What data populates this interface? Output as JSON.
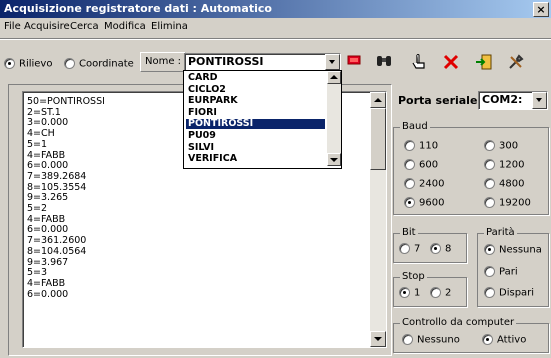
{
  "window": {
    "title": "Acquisizione registratore dati : Automatico",
    "close": "×"
  },
  "menu": [
    "File",
    "Acquisire",
    "Cerca",
    "Modifica",
    "Elimina"
  ],
  "toolbar": {
    "mode_options": [
      {
        "label": "Rilievo",
        "selected": true
      },
      {
        "label": "Coordinate",
        "selected": false
      }
    ],
    "nome_label": "Nome :",
    "nome_value": "PONTIROSSI"
  },
  "dropdown": {
    "items": [
      "CARD",
      "CICLO2",
      "EURPARK",
      "FIORI",
      "PONTIROSSI",
      "PU09",
      "SILVI",
      "VERIFICA"
    ],
    "selected": "PONTIROSSI"
  },
  "data_lines": [
    "50=PONTIROSSI",
    "2=ST.1",
    "3=0.000",
    "4=CH",
    "5=1",
    "4=FABB",
    "6=0.000",
    "7=389.2684",
    "8=105.3554",
    "9=3.265",
    "5=2",
    "4=FABB",
    "6=0.000",
    "7=361.2600",
    "8=104.0564",
    "9=3.967",
    "5=3",
    "4=FABB",
    "6=0.000"
  ],
  "serial": {
    "label": "Porta seriale",
    "value": "COM2:"
  },
  "baud": {
    "label": "Baud",
    "options": [
      {
        "label": "110",
        "selected": false
      },
      {
        "label": "300",
        "selected": false
      },
      {
        "label": "600",
        "selected": false
      },
      {
        "label": "1200",
        "selected": false
      },
      {
        "label": "2400",
        "selected": false
      },
      {
        "label": "4800",
        "selected": false
      },
      {
        "label": "9600",
        "selected": true
      },
      {
        "label": "19200",
        "selected": false
      }
    ]
  },
  "bit": {
    "label": "Bit",
    "options": [
      {
        "label": "7",
        "selected": false
      },
      {
        "label": "8",
        "selected": true
      }
    ]
  },
  "stop": {
    "label": "Stop",
    "options": [
      {
        "label": "1",
        "selected": true
      },
      {
        "label": "2",
        "selected": false
      }
    ]
  },
  "parita": {
    "label": "Parità",
    "options": [
      {
        "label": "Nessuna",
        "selected": true
      },
      {
        "label": "Pari",
        "selected": false
      },
      {
        "label": "Dispari",
        "selected": false
      }
    ]
  },
  "controllo": {
    "label": "Controllo da computer",
    "options": [
      {
        "label": "Nessuno",
        "selected": false
      },
      {
        "label": "Attivo",
        "selected": true
      }
    ]
  },
  "icons": [
    "flag-icon",
    "binoculars-icon",
    "hand-pointer-icon",
    "delete-x-icon",
    "exit-door-icon",
    "tools-icon"
  ]
}
